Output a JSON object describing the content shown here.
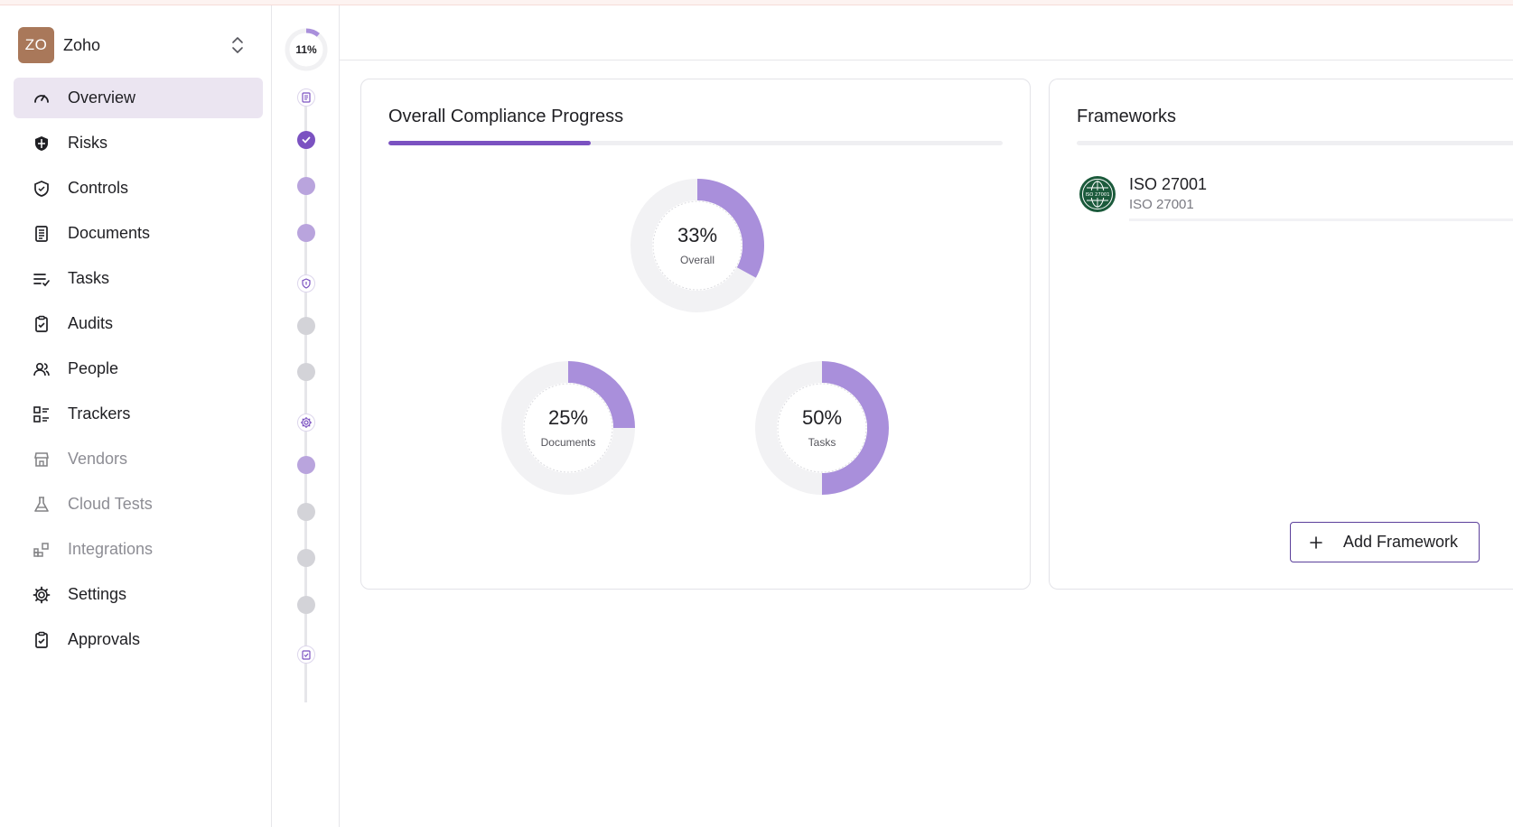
{
  "org": {
    "initials": "ZO",
    "name": "Zoho"
  },
  "sidebar": {
    "items": [
      {
        "label": "Overview",
        "icon": "gauge-icon",
        "active": true,
        "disabled": false
      },
      {
        "label": "Risks",
        "icon": "shield-solid-icon",
        "active": false,
        "disabled": false
      },
      {
        "label": "Controls",
        "icon": "shield-outline-icon",
        "active": false,
        "disabled": false
      },
      {
        "label": "Documents",
        "icon": "document-list-icon",
        "active": false,
        "disabled": false
      },
      {
        "label": "Tasks",
        "icon": "list-check-icon",
        "active": false,
        "disabled": false
      },
      {
        "label": "Audits",
        "icon": "clipboard-check-icon",
        "active": false,
        "disabled": false
      },
      {
        "label": "People",
        "icon": "people-icon",
        "active": false,
        "disabled": false
      },
      {
        "label": "Trackers",
        "icon": "tracker-grid-icon",
        "active": false,
        "disabled": false
      },
      {
        "label": "Vendors",
        "icon": "store-icon",
        "active": false,
        "disabled": true
      },
      {
        "label": "Cloud Tests",
        "icon": "flask-icon",
        "active": false,
        "disabled": true
      },
      {
        "label": "Integrations",
        "icon": "integrations-icon",
        "active": false,
        "disabled": true
      },
      {
        "label": "Settings",
        "icon": "gear-icon",
        "active": false,
        "disabled": false
      },
      {
        "label": "Approvals",
        "icon": "clipboard-check-icon",
        "active": false,
        "disabled": false
      }
    ]
  },
  "rail": {
    "progress_label": "11%",
    "progress_value": 0.11
  },
  "compliance": {
    "title": "Overall Compliance Progress",
    "progress_value": 0.33,
    "overall": {
      "pct_label": "33%",
      "name": "Overall",
      "value": 0.33
    },
    "documents": {
      "pct_label": "25%",
      "name": "Documents",
      "value": 0.25
    },
    "tasks": {
      "pct_label": "50%",
      "name": "Tasks",
      "value": 0.5
    }
  },
  "frameworks": {
    "title": "Frameworks",
    "items": [
      {
        "name": "ISO 27001",
        "subtitle": "ISO 27001",
        "logo_text": "ISO 27001"
      }
    ],
    "add_label": "Add Framework"
  },
  "colors": {
    "accent": "#7b52c1",
    "accent_light": "#a98fdb",
    "track": "#f2f2f4"
  }
}
